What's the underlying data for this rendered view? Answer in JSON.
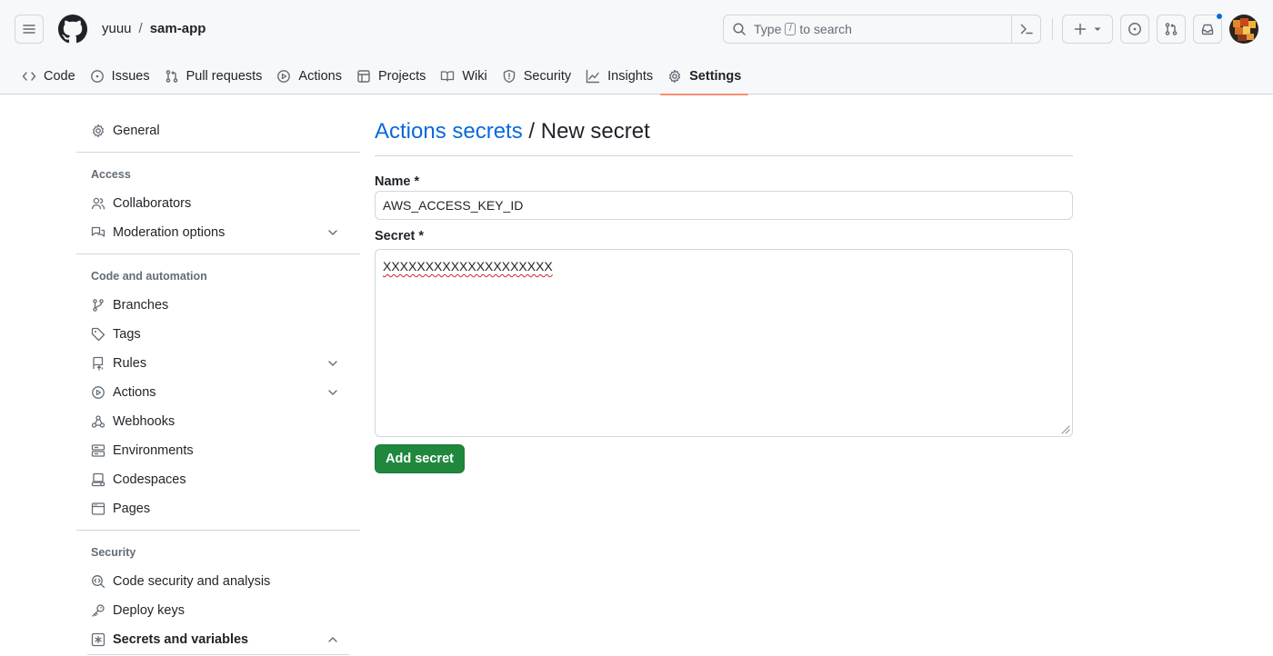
{
  "header": {
    "owner": "yuuu",
    "separator": "/",
    "repo": "sam-app",
    "search_placeholder_before": "Type",
    "search_key": "/",
    "search_placeholder_after": "to search",
    "notification_dot_color": "#0969da"
  },
  "tabs": [
    {
      "label": "Code",
      "icon": "code-icon"
    },
    {
      "label": "Issues",
      "icon": "issue-icon"
    },
    {
      "label": "Pull requests",
      "icon": "pull-request-icon"
    },
    {
      "label": "Actions",
      "icon": "play-icon"
    },
    {
      "label": "Projects",
      "icon": "table-icon"
    },
    {
      "label": "Wiki",
      "icon": "book-icon"
    },
    {
      "label": "Security",
      "icon": "shield-icon"
    },
    {
      "label": "Insights",
      "icon": "graph-icon"
    },
    {
      "label": "Settings",
      "icon": "gear-icon",
      "active": true
    }
  ],
  "sidebar": {
    "general": "General",
    "access_heading": "Access",
    "collaborators": "Collaborators",
    "moderation": "Moderation options",
    "code_heading": "Code and automation",
    "branches": "Branches",
    "tags": "Tags",
    "rules": "Rules",
    "actions": "Actions",
    "webhooks": "Webhooks",
    "environments": "Environments",
    "codespaces": "Codespaces",
    "pages": "Pages",
    "security_heading": "Security",
    "code_security": "Code security and analysis",
    "deploy_keys": "Deploy keys",
    "secrets": "Secrets and variables"
  },
  "main": {
    "title_link": "Actions secrets",
    "title_rest": " / New secret",
    "name_label": "Name *",
    "name_value": "AWS_ACCESS_KEY_ID",
    "secret_label": "Secret *",
    "secret_value": "XXXXXXXXXXXXXXXXXXXX",
    "submit_label": "Add secret"
  },
  "colors": {
    "accent_link": "#0969da",
    "primary_button": "#1f883d",
    "active_tab_underline": "#fd8c73"
  }
}
